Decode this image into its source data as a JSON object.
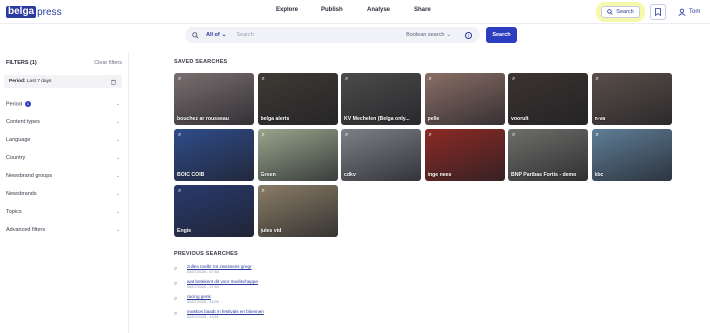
{
  "header": {
    "logo_prefix": "belga",
    "logo_suffix": "press",
    "nav": [
      "Explore",
      "Publish",
      "Analyse",
      "Share"
    ],
    "search_button": "Search",
    "user_name": "Tom"
  },
  "searchbar": {
    "scope": "All of",
    "placeholder": "Search",
    "boolean": "Boolean search",
    "submit": "Search"
  },
  "sidebar": {
    "title": "FILTERS (1)",
    "clear": "Clear filters",
    "active_chip": {
      "key": "Period:",
      "value": "Last 7 days"
    },
    "period_badge": "1",
    "filters": [
      "Period",
      "Content types",
      "Language",
      "Country",
      "Newsbrand groups",
      "Newsbrands",
      "Topics",
      "Advanced filters"
    ]
  },
  "saved": {
    "title": "SAVED SEARCHES",
    "tiles": [
      {
        "label": "bouchez ar rousseau",
        "color": "#7a6f70"
      },
      {
        "label": "belga alerts",
        "color": "#3f3a34"
      },
      {
        "label": "KV Mechelen (Belga only...",
        "color": "#4d4b4a"
      },
      {
        "label": "pelle",
        "color": "#8a6e66"
      },
      {
        "label": "voorult",
        "color": "#3b3430"
      },
      {
        "label": "n-va",
        "color": "#5a4f48"
      },
      {
        "label": "BOIC COIB",
        "color": "#2f4c8a"
      },
      {
        "label": "Groen",
        "color": "#97a58c"
      },
      {
        "label": "cdkv",
        "color": "#7d8086"
      },
      {
        "label": "inge nees",
        "color": "#8c2a24"
      },
      {
        "label": "BNP Paribas Fortis - demo",
        "color": "#6e6e6a"
      },
      {
        "label": "kbc",
        "color": "#5f7e97"
      },
      {
        "label": "Engie",
        "color": "#293a6e"
      },
      {
        "label": "jules vid",
        "color": "#8a7d66"
      }
    ]
  },
  "previous": {
    "title": "PREVIOUS SEARCHES",
    "items": [
      {
        "text": "zullen toelbr tot zwessens gregr",
        "date": "04/07/2025 - 07:53"
      },
      {
        "text": "wat betekent dit voor medischappe",
        "date": "04/07/2025 - 07:53"
      },
      {
        "text": "racing genk",
        "date": "02/07/2025 - 14:00"
      },
      {
        "text": "moskos baadt m festivals en bloemen",
        "date": "02/07/2025 - 13:51"
      }
    ]
  }
}
